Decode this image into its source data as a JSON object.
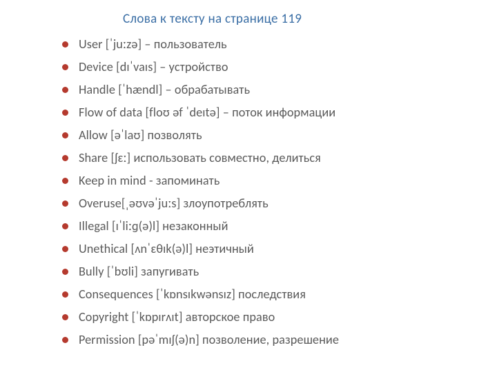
{
  "title": "Слова к тексту на странице 119",
  "items": [
    "User [ˈjuːzə] – пользователь",
    "Device [dɪˈvaɪs] – устройство",
    "Handle [ˈhændl] – обрабатывать",
    "Flow of data [floʊ əf ˈdeɪtə] – поток информации",
    "Allow [əˈlaʊ] позволять",
    "Share [ʃɛː] использовать совместно, делиться",
    "Keep in mind - запоминать",
    "Overuse[ˌəʊvəˈjuːs]  злоупотреблять",
    "Illegal [ɪˈliːɡ(ə)l] незаконный",
    "Unethical [ʌnˈɛθɪk(ə)l]   неэтичный",
    "Bully [ˈbʊli] запугивать",
    "Consequences [ˈkɒnsɪkwənsɪz] последствия",
    "Copyright [ˈkɒpɪrʌɪt] авторское право",
    "Permission [pəˈmɪʃ(ə)n]  позволение, разрешение"
  ]
}
